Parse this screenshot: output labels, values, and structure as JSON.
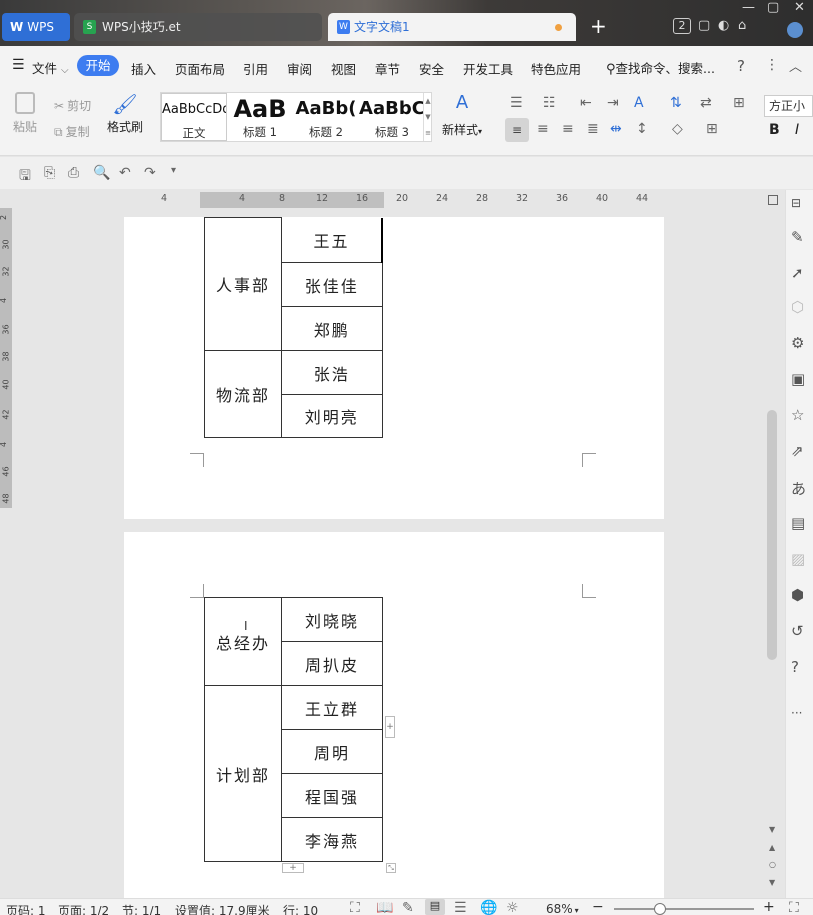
{
  "titlebar": {
    "home_label": "WPS",
    "tabs": [
      {
        "label": "WPS小技巧.et",
        "icon": "S"
      },
      {
        "label": "文字文稿1",
        "icon": "W"
      }
    ],
    "new_tab": "+",
    "window_count": "2"
  },
  "menu": {
    "file_label": "文件",
    "items": [
      "开始",
      "插入",
      "页面布局",
      "引用",
      "审阅",
      "视图",
      "章节",
      "安全",
      "开发工具",
      "特色应用"
    ],
    "search_placeholder": "查找命令、搜索..."
  },
  "ribbon": {
    "paste": "粘贴",
    "cut": "剪切",
    "copy": "复制",
    "format_painter": "格式刷",
    "styles": [
      {
        "sample": "AaBbCcDd",
        "name": "正文"
      },
      {
        "sample": "AaB",
        "name": "标题 1"
      },
      {
        "sample": "AaBb(",
        "name": "标题 2"
      },
      {
        "sample": "AaBbC",
        "name": "标题 3"
      }
    ],
    "new_style": "新样式",
    "font_name": "方正小"
  },
  "ruler": {
    "ticks": [
      "4",
      "4",
      "8",
      "12",
      "16",
      "20",
      "24",
      "28",
      "32",
      "36",
      "40",
      "44"
    ]
  },
  "vruler": {
    "ticks": [
      "2",
      "30",
      "32",
      "4",
      "36",
      "38",
      "40",
      "42",
      "4",
      "46",
      "48"
    ]
  },
  "document": {
    "page1_table": [
      {
        "dept": "人事部",
        "people": [
          "王五",
          "张佳佳",
          "郑鹏"
        ]
      },
      {
        "dept": "物流部",
        "people": [
          "张浩",
          "刘明亮"
        ]
      }
    ],
    "page2_table": [
      {
        "dept": "总经办",
        "people": [
          "刘晓晓",
          "周扒皮"
        ]
      },
      {
        "dept": "计划部",
        "people": [
          "王立群",
          "周明",
          "程国强",
          "李海燕"
        ]
      }
    ]
  },
  "status": {
    "page_number": "页码: 1",
    "pages": "页面: 1/2",
    "section": "节: 1/1",
    "setting": "设置值: 17.9厘米",
    "line": "行: 10",
    "zoom": "68%"
  }
}
